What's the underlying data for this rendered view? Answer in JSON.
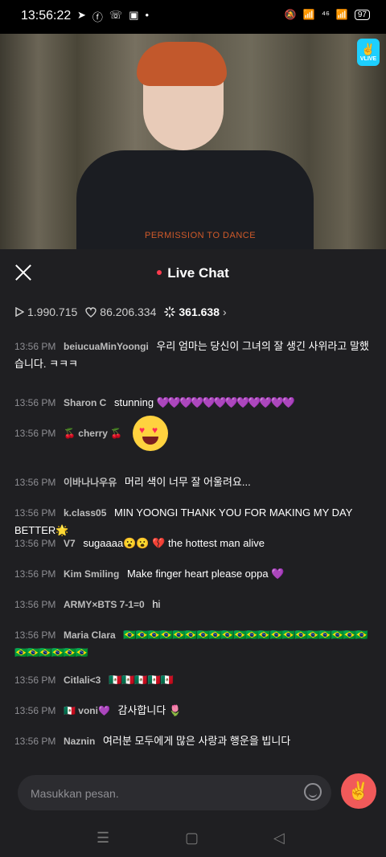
{
  "status": {
    "time": "13:56:22",
    "left_icons": [
      "➤",
      "ⓕ",
      "☏",
      "▣",
      "•"
    ],
    "right_icons": [
      "🔕",
      "📶",
      "⁴⁶",
      "📶"
    ],
    "battery": "97"
  },
  "video": {
    "shirt_text": "PERMISSION TO DANCE",
    "logo_text": "VLIVE"
  },
  "header": {
    "title": "Live Chat"
  },
  "stats": {
    "plays": "1.990.715",
    "likes": "86.206.334",
    "viewers": "361.638"
  },
  "messages": [
    {
      "time": "13:56 PM",
      "user": "beiucuaMinYoongi",
      "text": "우리 엄마는 당신이 그녀의 잘 생긴 사위라고 말했습니다. ㅋㅋㅋ"
    },
    {
      "time": "13:56 PM",
      "user": "Sharon C",
      "text": "stunning",
      "extra": "💜💜💜💜💜💜💜💜💜💜💜💜"
    },
    {
      "time": "13:56 PM",
      "user": "🍒 cherry 🍒",
      "text": ""
    },
    {
      "time": "13:56 PM",
      "user": "이바나나우유",
      "text": "머리 색이 너무 잘 어울려요..."
    },
    {
      "time": "13:56 PM",
      "user": "k.class05",
      "text": "MIN YOONGI THANK YOU FOR MAKING MY DAY BETTER🌟"
    },
    {
      "time": "13:56 PM",
      "user": "V7",
      "text": "sugaaaa😮😮 💔 the hottest man alive"
    },
    {
      "time": "13:56 PM",
      "user": "Kim Smiling",
      "text": "Make finger heart please oppa 💜"
    },
    {
      "time": "13:56 PM",
      "user": "ARMY×BTS 7-1=0",
      "text": "hi"
    },
    {
      "time": "13:56 PM",
      "user": "Maria Clara",
      "text": "🇧🇷🇧🇷🇧🇷🇧🇷🇧🇷🇧🇷🇧🇷🇧🇷🇧🇷🇧🇷🇧🇷🇧🇷🇧🇷🇧🇷🇧🇷🇧🇷🇧🇷🇧🇷🇧🇷🇧🇷🇧🇷🇧🇷🇧🇷🇧🇷🇧🇷🇧🇷"
    },
    {
      "time": "13:56 PM",
      "user": "Citlali<3",
      "text": "🇲🇽🇲🇽🇲🇽🇲🇽🇲🇽"
    },
    {
      "time": "13:56 PM",
      "user": "🇲🇽 voni💜",
      "text": "감사합니다 🌷"
    },
    {
      "time": "13:56 PM",
      "user": "Naznin",
      "text": "여러분 모두에게 많은 사랑과 행운을 빕니다"
    }
  ],
  "input": {
    "placeholder": "Masukkan pesan."
  },
  "nav": {
    "recent": "☰",
    "home": "▢",
    "back": "◁"
  }
}
